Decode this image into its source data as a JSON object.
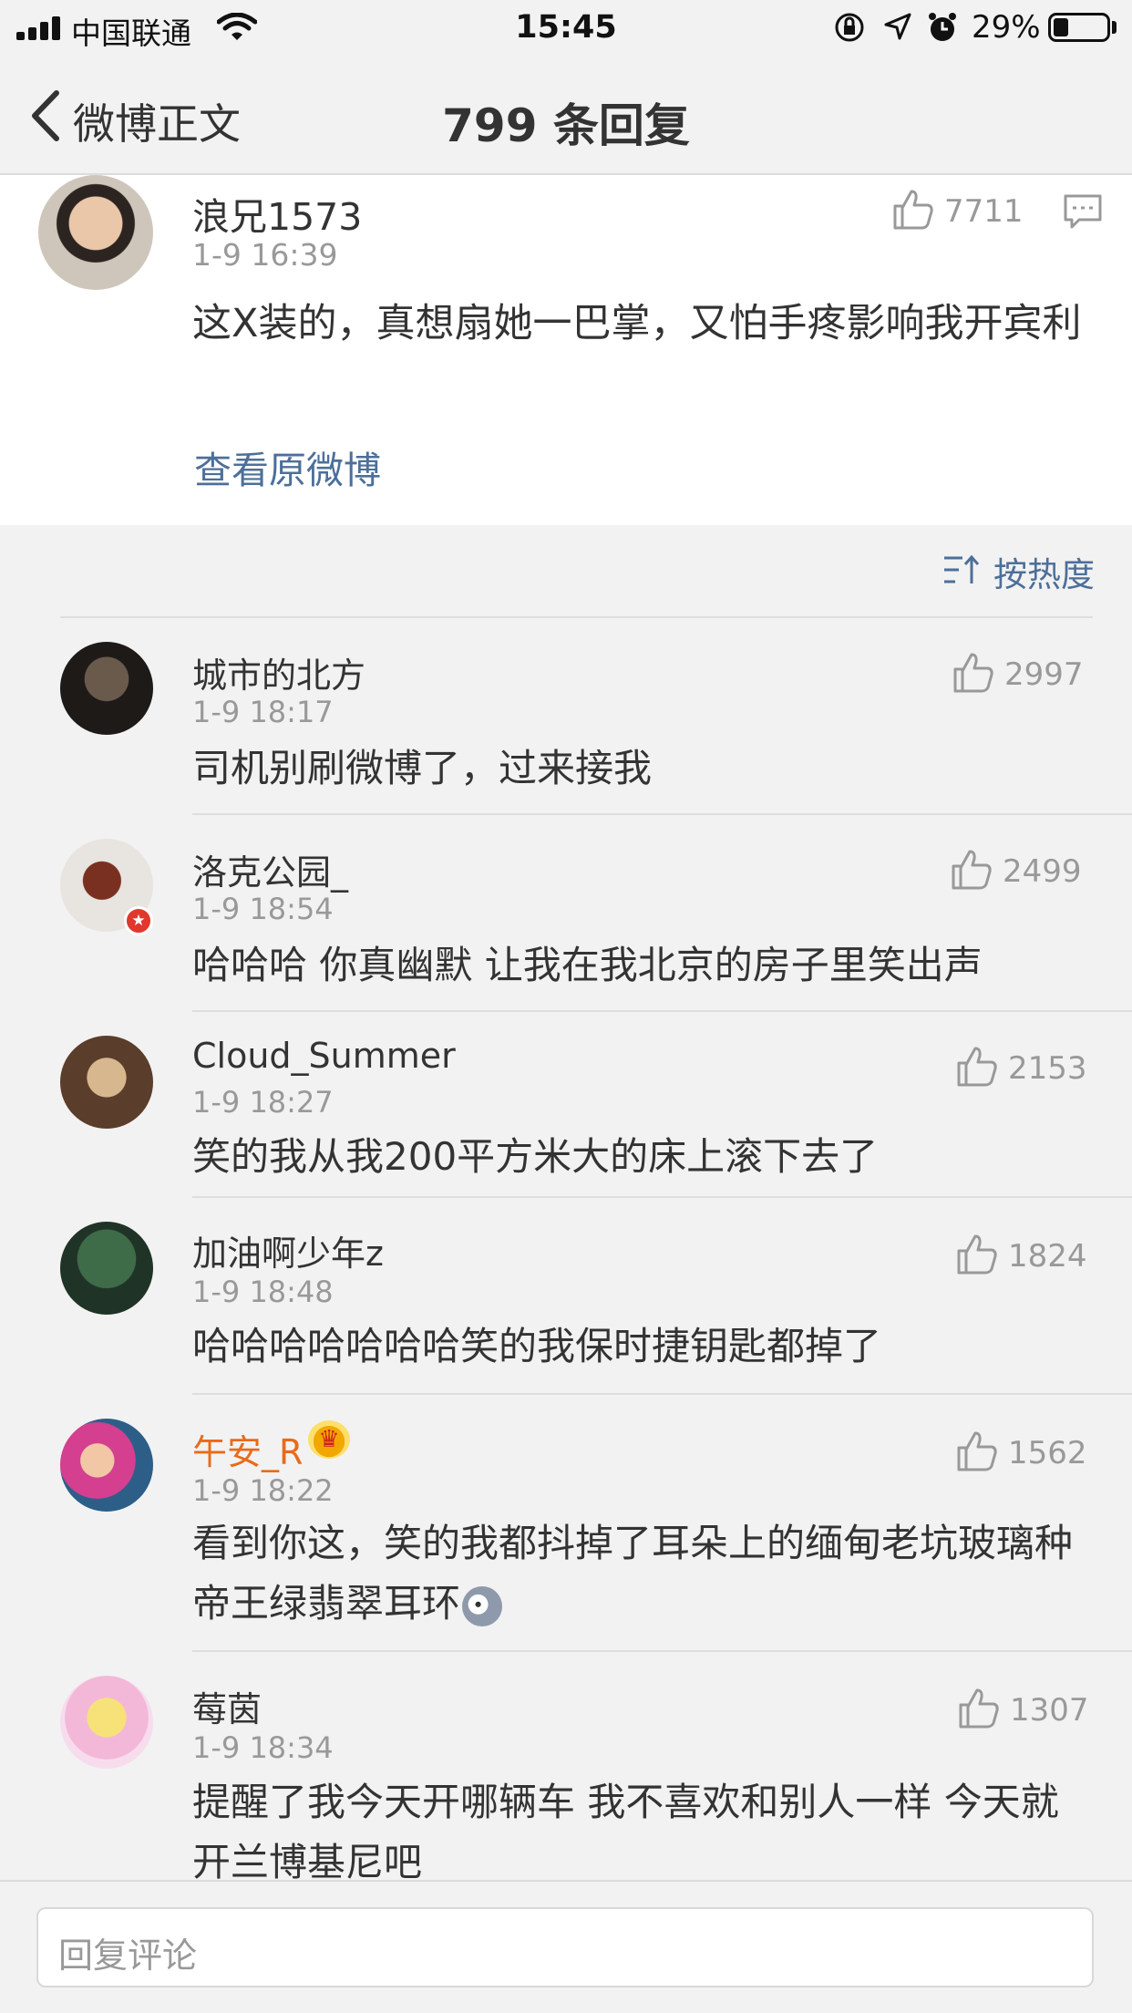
{
  "status_bar": {
    "carrier": "中国联通",
    "time": "15:45",
    "battery_percent_label": "29%",
    "battery_level": 0.29
  },
  "nav": {
    "back_label": "微博正文",
    "title": "799 条回复"
  },
  "main_comment": {
    "user": "浪兄1573",
    "time": "1-9 16:39",
    "likes": "7711",
    "text": "这X装的，真想扇她一巴掌，又怕手疼影响我开宾利",
    "view_original": "查看原微博"
  },
  "sort": {
    "label": "按热度"
  },
  "replies": [
    {
      "user": "城市的北方",
      "time": "1-9 18:17",
      "likes": "2997",
      "text": "司机别刷微博了，过来接我"
    },
    {
      "user": "洛克公园_",
      "time": "1-9 18:54",
      "likes": "2499",
      "text": "哈哈哈 你真幽默 让我在我北京的房子里笑出声"
    },
    {
      "user": "Cloud_Summer",
      "time": "1-9 18:27",
      "likes": "2153",
      "text": "笑的我从我200平方米大的床上滚下去了"
    },
    {
      "user": "加油啊少年z",
      "time": "1-9 18:48",
      "likes": "1824",
      "text": "哈哈哈哈哈哈哈笑的我保时捷钥匙都掉了"
    },
    {
      "user": "午安_R",
      "time": "1-9 18:22",
      "likes": "1562",
      "text": "看到你这，笑的我都抖掉了耳朵上的缅甸老坑玻璃种帝王绿翡翠耳环"
    },
    {
      "user": "莓茵",
      "time": "1-9 18:34",
      "likes": "1307",
      "text": "提醒了我今天开哪辆车 我不喜欢和别人一样 今天就开兰博基尼吧"
    }
  ],
  "reply_input": {
    "placeholder": "回复评论"
  },
  "colors": {
    "link_blue": "#4d6f99",
    "vip_orange": "#e86b1a",
    "secondary_text": "#999999",
    "background": "#f2f2f2"
  }
}
